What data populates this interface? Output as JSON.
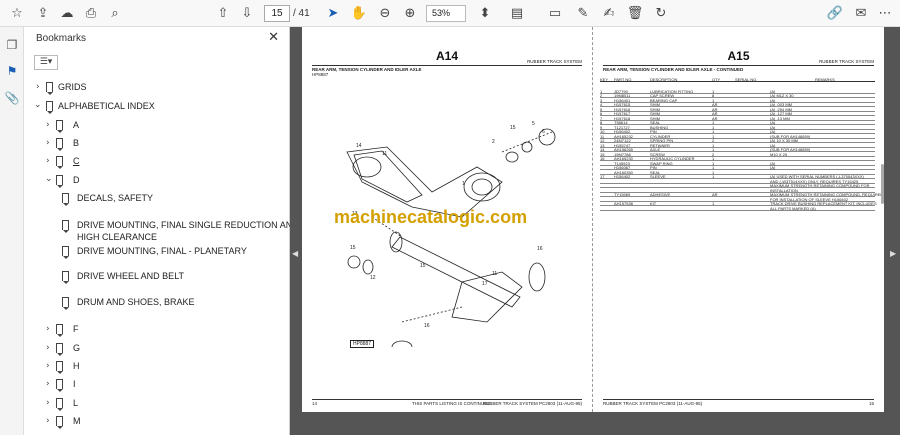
{
  "toolbar": {
    "current_page": "15",
    "total_pages": "/ 41",
    "zoom": "53%"
  },
  "panel": {
    "title": "Bookmarks",
    "items": [
      {
        "label": "GRIDS"
      },
      {
        "label": "ALPHABETICAL INDEX"
      },
      {
        "label": "A"
      },
      {
        "label": "B"
      },
      {
        "label": "C"
      },
      {
        "label": "D"
      },
      {
        "label": "DECALS, SAFETY"
      },
      {
        "label": "DRIVE MOUNTING, FINAL  SINGLE REDUCTION AND"
      },
      {
        "label": "HIGH CLEARANCE"
      },
      {
        "label": "DRIVE MOUNTING, FINAL - PLANETARY"
      },
      {
        "label": "DRIVE WHEEL AND BELT"
      },
      {
        "label": "DRUM AND SHOES, BRAKE"
      },
      {
        "label": "F"
      },
      {
        "label": "G"
      },
      {
        "label": "H"
      },
      {
        "label": "I"
      },
      {
        "label": "L"
      },
      {
        "label": "M"
      }
    ]
  },
  "doc": {
    "left": {
      "title": "A14",
      "section": "RUBBER TRACK SYSTEM",
      "subtitle": "REAR ARM, TENSION CYLINDER AND IDLER AXLE",
      "fig": "HP8887",
      "fig_label": "HP8887",
      "footer_left": "14",
      "footer_mid": "THIS PARTS LISTING IS CONTINUED",
      "footer_right": "RUBBER TRACK SYSTEM  PC2803  (11-AUG-95)"
    },
    "right": {
      "title": "A15",
      "section": "RUBBER TRACK SYSTEM",
      "subtitle": "REAR ARM, TENSION CYLINDER AND IDLER AXLE - CONTINUED",
      "header": [
        "KEY",
        "PART NO.",
        "DESCRIPTION",
        "QTY",
        "SERIAL NO.",
        "REMARKS"
      ],
      "rows": [
        [
          "1",
          "JD7790",
          "LUBRICATION FITTING",
          "1",
          "",
          "(A)"
        ],
        [
          "2",
          "19M8011",
          "CAP SCREW",
          "8",
          "",
          "(A) M12 X 30"
        ],
        [
          "3",
          "H156401",
          "BEARING CAP",
          "1",
          "",
          "(A)"
        ],
        [
          "4",
          "H157615",
          "SHIM",
          "AR",
          "",
          "(A) .003 MM"
        ],
        [
          "5",
          "H157616",
          "SHIM",
          "AR",
          "",
          "(A) .254 MM"
        ],
        [
          "6",
          "H157617",
          "SHIM",
          "AR",
          "",
          "(A) .127 MM"
        ],
        [
          "7",
          "H157618",
          "SHIM",
          "AR",
          "",
          "(A) .13 MM"
        ],
        [
          "8",
          "T58614",
          "SEAL",
          "1",
          "",
          "(A)"
        ],
        [
          "9",
          "T121727",
          "BUSHING",
          "1",
          "",
          "(A)"
        ],
        [
          "10",
          "H156402",
          "PIN",
          "1",
          "",
          "(A)"
        ],
        [
          "11",
          "AH165232",
          "CYLINDER",
          "1",
          "",
          "(SUB FOR AH148859)"
        ],
        [
          "12",
          "24M7122",
          "SPRING PIN",
          "2",
          "",
          "(A) 10 X 30 MM"
        ],
        [
          "13",
          "H155747",
          "RETAINER",
          "1",
          "",
          "(A)"
        ],
        [
          "14",
          "AH156265",
          "AXLE",
          "1",
          "",
          "(SUB FOR AH148859)"
        ],
        [
          "15",
          "19M7788",
          "SCREW",
          "2",
          "",
          "M10 X 25"
        ],
        [
          "16",
          "AH165230",
          "HYDRAULIC CYLINDER",
          "1",
          "",
          ""
        ],
        [
          "",
          "T145923",
          "SWAP RING",
          "1",
          "",
          "(A)"
        ],
        [
          "",
          "H156067",
          "PIN",
          "1",
          "",
          "(A)"
        ],
        [
          "",
          "AH160350",
          "SEAL",
          "1",
          "",
          ""
        ],
        [
          "17",
          "H156402",
          "SLEEVE",
          "1",
          "",
          "(A) USED WITH SERIAL NUMBERS (-L375543XXX)"
        ],
        [
          "",
          "",
          "",
          "",
          "",
          "AND (-W3T514XXX) ONLY. REQUIRES TY15425"
        ],
        [
          "",
          "",
          "",
          "",
          "",
          "MAXIMUM STRENGTH RETAINING COMPOUND FOR"
        ],
        [
          "",
          "",
          "",
          "",
          "",
          "INSTALLATION"
        ],
        [
          "",
          "TY15969",
          "ADHESIVE",
          "AR",
          "",
          "MAXIMUM STRENGTH RETAINING COMPOUND, REQUIRED"
        ],
        [
          "",
          "",
          "",
          "",
          "",
          "FOR INSTALLATION OF SLEEVE H156402"
        ],
        [
          "",
          "AH157538",
          "KIT",
          "1",
          "",
          "TRACK DRIVE BUSHING REPLACEMENT KIT, INCLUDES"
        ],
        [
          "",
          "",
          "",
          "",
          "",
          "ALL PARTS MARKED (A)"
        ]
      ],
      "footer_left": "RUBBER TRACK SYSTEM  PC2803  (11-AUG-95)",
      "footer_right": "15"
    },
    "watermark": "machinecatalogic.com"
  }
}
